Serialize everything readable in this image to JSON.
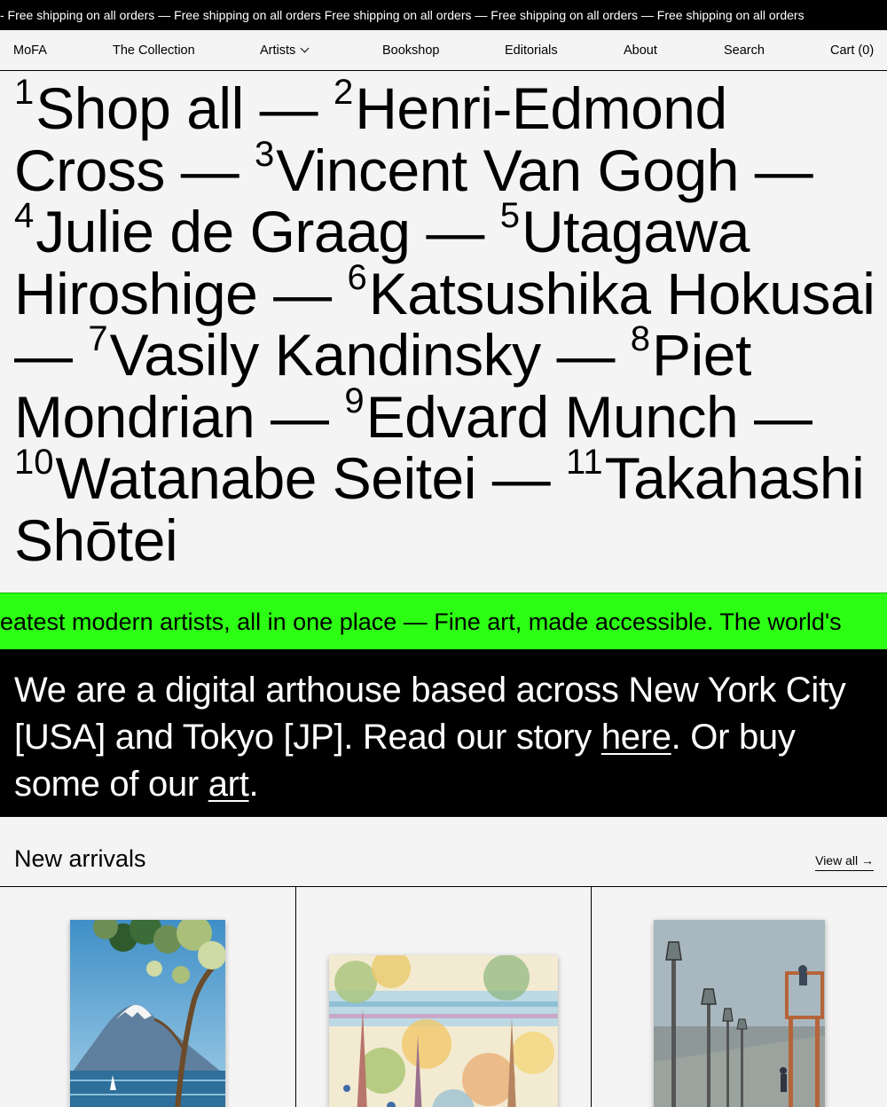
{
  "banner": {
    "text": "- Free shipping on all orders — Free shipping on all orders Free shipping on all orders — Free shipping on all orders — Free shipping on all orders"
  },
  "nav": {
    "logo": "MoFA",
    "collection": "The Collection",
    "artists": "Artists",
    "bookshop": "Bookshop",
    "editorials": "Editorials",
    "about": "About",
    "search": "Search",
    "cart": "Cart (0)"
  },
  "artists": [
    {
      "num": "1",
      "name": "Shop all"
    },
    {
      "num": "2",
      "name": "Henri-Edmond Cross"
    },
    {
      "num": "3",
      "name": "Vincent Van Gogh"
    },
    {
      "num": "4",
      "name": "Julie de Graag"
    },
    {
      "num": "5",
      "name": "Utagawa Hiroshige"
    },
    {
      "num": "6",
      "name": "Katsushika Hokusai"
    },
    {
      "num": "7",
      "name": "Vasily Kandinsky"
    },
    {
      "num": "8",
      "name": "Piet Mondrian"
    },
    {
      "num": "9",
      "name": "Edvard Munch"
    },
    {
      "num": "10",
      "name": "Watanabe Seitei"
    },
    {
      "num": "11",
      "name": "Takahashi Shōtei"
    }
  ],
  "separator": "—",
  "ticker": {
    "text": "eatest modern artists, all in one place — Fine art, made accessible. The world's"
  },
  "about": {
    "text_1": "We are a digital arthouse based across New York City [USA] and Tokyo [JP]. Read our story ",
    "link_here": "here",
    "text_2": ". Or buy some of our ",
    "link_art": "art",
    "text_3": "."
  },
  "arrivals": {
    "title": "New arrivals",
    "view_all": "View all →"
  },
  "colors": {
    "accent_green": "#2dff14",
    "black": "#000000",
    "background": "#f4f4f4"
  }
}
